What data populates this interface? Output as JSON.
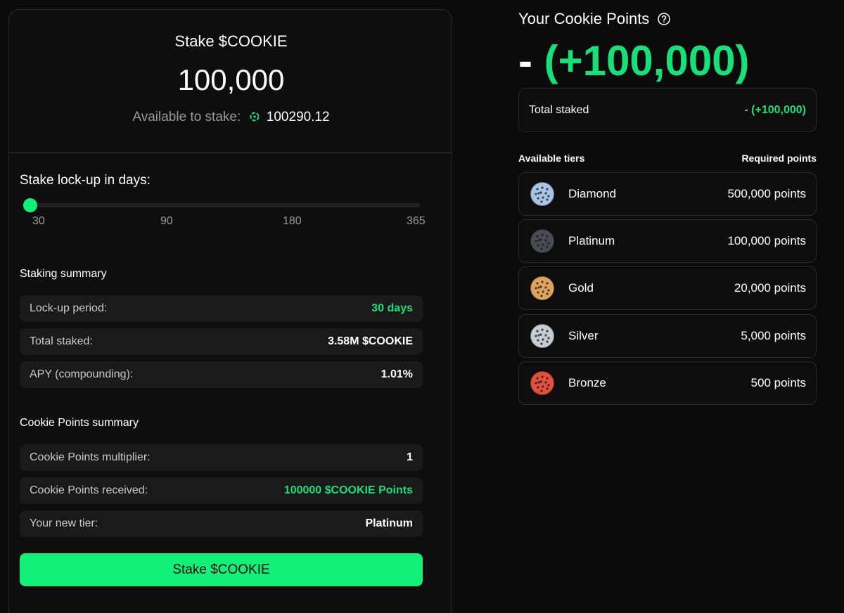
{
  "stake": {
    "title": "Stake $COOKIE",
    "amount": "100,000",
    "available_label": "Available to stake:",
    "available_value": "100290.12",
    "lockup_label": "Stake lock-up in days:",
    "slider": {
      "value": 30,
      "min": 30,
      "max": 365,
      "ticks": [
        "30",
        "90",
        "180",
        "365"
      ]
    },
    "staking_summary": {
      "title": "Staking summary",
      "rows": [
        {
          "label": "Lock-up period:",
          "value": "30 days"
        },
        {
          "label": "Total staked:",
          "value": "3.58M $COOKIE"
        },
        {
          "label": "APY (compounding):",
          "value": "1.01%"
        }
      ]
    },
    "points_summary": {
      "title": "Cookie Points summary",
      "rows": [
        {
          "label": "Cookie Points multiplier:",
          "value": "1"
        },
        {
          "label": "Cookie Points received:",
          "value": "100000 $COOKIE Points"
        },
        {
          "label": "Your new tier:",
          "value": "Platinum"
        }
      ]
    },
    "button_label": "Stake $COOKIE"
  },
  "points": {
    "title": "Your Cookie Points",
    "big_dash": "-",
    "big_value": "(+100,000)",
    "total_label": "Total staked",
    "total_dash": "-",
    "total_value": "(+100,000)",
    "tiers_label": "Available tiers",
    "required_label": "Required points",
    "tiers": [
      {
        "name": "Diamond",
        "points": "500,000 points",
        "color": "#a9c4e6"
      },
      {
        "name": "Platinum",
        "points": "100,000 points",
        "color": "#4a4d52"
      },
      {
        "name": "Gold",
        "points": "20,000 points",
        "color": "#e0a25c"
      },
      {
        "name": "Silver",
        "points": "5,000 points",
        "color": "#c6ccd0"
      },
      {
        "name": "Bronze",
        "points": "500 points",
        "color": "#e0523b"
      }
    ]
  },
  "colors": {
    "accent": "#12f07a",
    "green_text": "#16e07a",
    "background": "#0b0b0b"
  }
}
